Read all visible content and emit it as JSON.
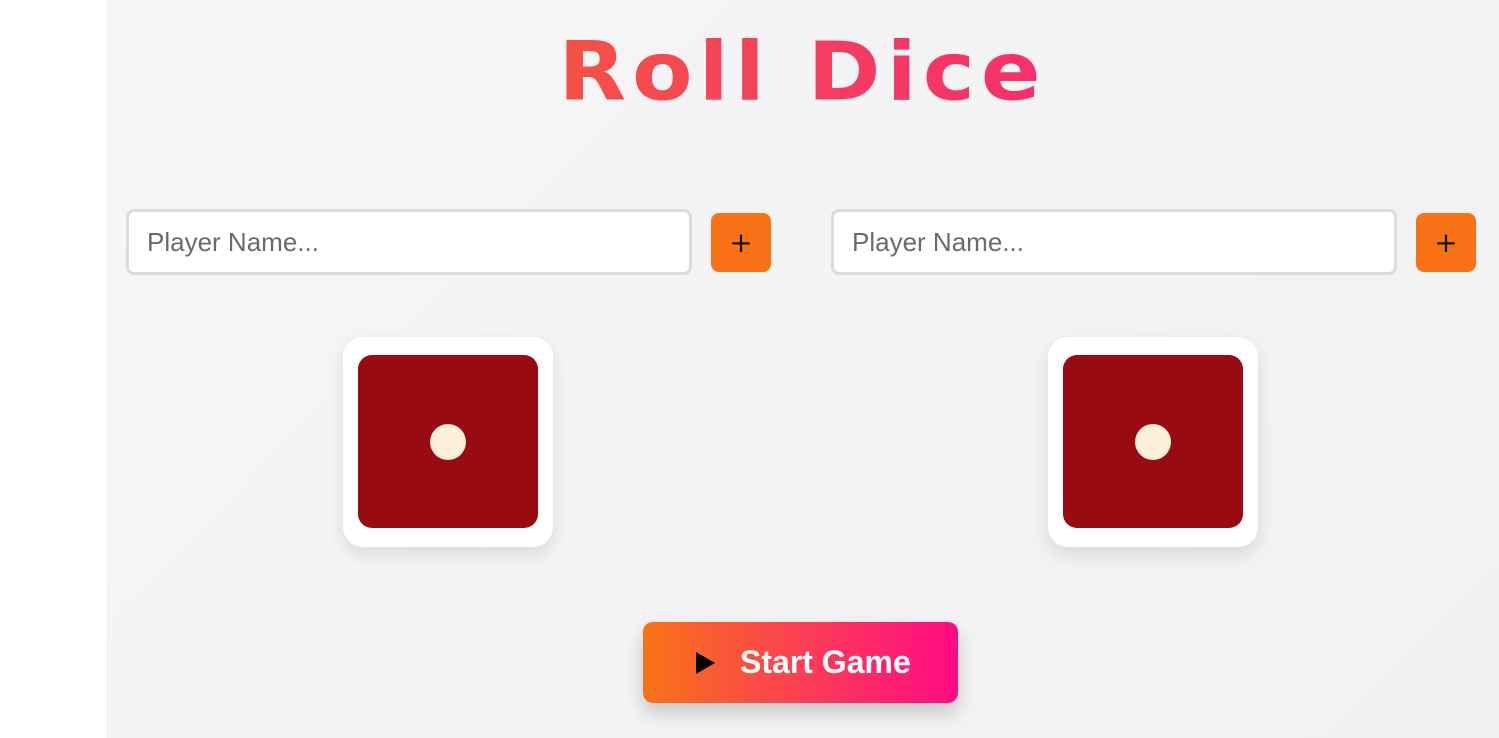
{
  "title": "Roll Dice",
  "players": [
    {
      "placeholder": "Player Name...",
      "value": "",
      "add_label": "+",
      "die_value": 1
    },
    {
      "placeholder": "Player Name...",
      "value": "",
      "add_label": "+",
      "die_value": 1
    }
  ],
  "start_button": {
    "label": "Start Game",
    "icon": "play-icon"
  },
  "colors": {
    "accent": "#f97316",
    "gradient_end": "#ff0a84",
    "die_face": "#990b12",
    "pip": "#fbf1d8"
  }
}
